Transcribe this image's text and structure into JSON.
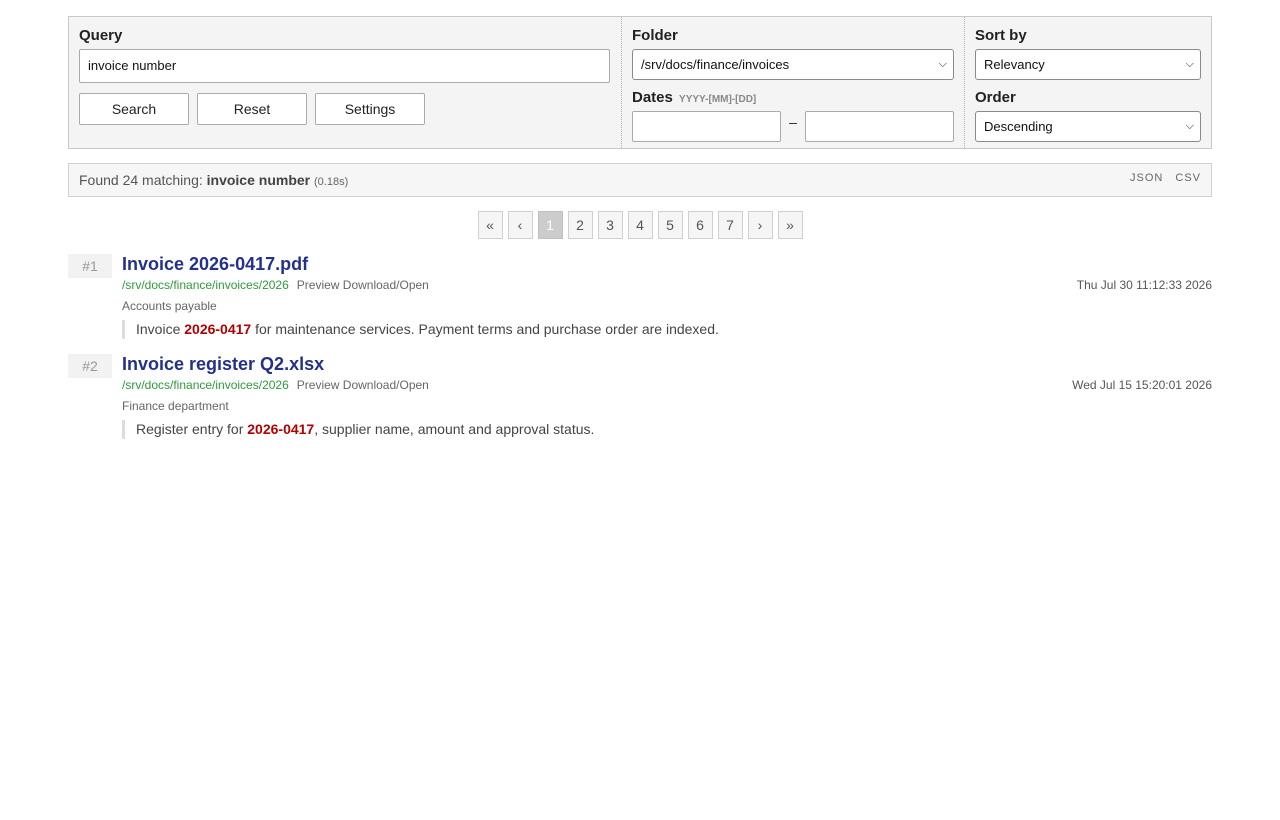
{
  "form": {
    "query_label": "Query",
    "query_value": "invoice number",
    "buttons": {
      "search": "Search",
      "reset": "Reset",
      "settings": "Settings"
    },
    "folder_label": "Folder",
    "folder_value": "/srv/docs/finance/invoices",
    "dates_label": "Dates",
    "dates_hint": "YYYY-[MM]-[DD]",
    "dates_separator": "–",
    "date_from": "",
    "date_to": "",
    "sort_label": "Sort by",
    "sort_value": "Relevancy",
    "order_label": "Order",
    "order_value": "Descending"
  },
  "results_bar": {
    "prefix": "Found 24 matching: ",
    "query": "invoice number",
    "timing": "(0.18s)",
    "export_json": "JSON",
    "export_csv": "CSV"
  },
  "pagination": {
    "first": "«",
    "prev": "‹",
    "pages": [
      "1",
      "2",
      "3",
      "4",
      "5",
      "6",
      "7"
    ],
    "current": "1",
    "next": "›",
    "last": "»"
  },
  "results": [
    {
      "rank": "#1",
      "title": "Invoice 2026-0417.pdf",
      "path": "/srv/docs/finance/invoices/2026",
      "links": "Preview Download/Open",
      "date": "Thu Jul 30 11:12:33 2026",
      "category": "Accounts payable",
      "snippet_before": "Invoice ",
      "snippet_highlight": "2026-0417",
      "snippet_after": " for maintenance services. Payment terms and purchase order are indexed."
    },
    {
      "rank": "#2",
      "title": "Invoice register Q2.xlsx",
      "path": "/srv/docs/finance/invoices/2026",
      "links": "Preview Download/Open",
      "date": "Wed Jul 15 15:20:01 2026",
      "category": "Finance department",
      "snippet_before": "Register entry for ",
      "snippet_highlight": "2026-0417",
      "snippet_after": ", supplier name, amount and approval status."
    }
  ],
  "colors": {
    "title_link": "#23318c",
    "path_link": "#2e9a3a",
    "highlight": "#b00000"
  }
}
